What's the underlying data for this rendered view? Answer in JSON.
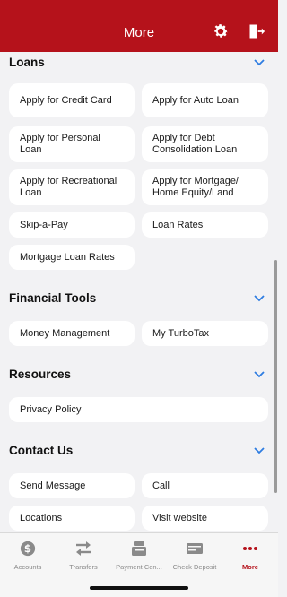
{
  "header": {
    "title": "More",
    "settings_icon": "gear-icon",
    "logout_icon": "exit-door-icon",
    "color": "#b5121b"
  },
  "sections": {
    "loans": {
      "title": "Loans",
      "items": [
        "Apply for Credit Card",
        "Apply for Auto Loan",
        "Apply for Personal Loan",
        "Apply for Debt Consolidation Loan",
        "Apply for Recreational Loan",
        "Apply for Mortgage/ Home Equity/Land",
        "Skip-a-Pay",
        "Loan Rates",
        "Mortgage Loan Rates"
      ]
    },
    "financial_tools": {
      "title": "Financial Tools",
      "items": [
        "Money Management",
        "My TurboTax"
      ]
    },
    "resources": {
      "title": "Resources",
      "items": [
        "Privacy Policy"
      ]
    },
    "contact_us": {
      "title": "Contact Us",
      "items": [
        "Send Message",
        "Call",
        "Locations",
        "Visit website"
      ]
    }
  },
  "tabbar": {
    "items": [
      {
        "label": "Accounts",
        "icon": "dollar-circle-icon"
      },
      {
        "label": "Transfers",
        "icon": "transfer-arrows-icon"
      },
      {
        "label": "Payment Cen...",
        "icon": "payment-center-icon"
      },
      {
        "label": "Check Deposit",
        "icon": "check-deposit-icon"
      },
      {
        "label": "More",
        "icon": "more-dots-icon"
      }
    ],
    "active": "More",
    "active_color": "#b5121b"
  }
}
